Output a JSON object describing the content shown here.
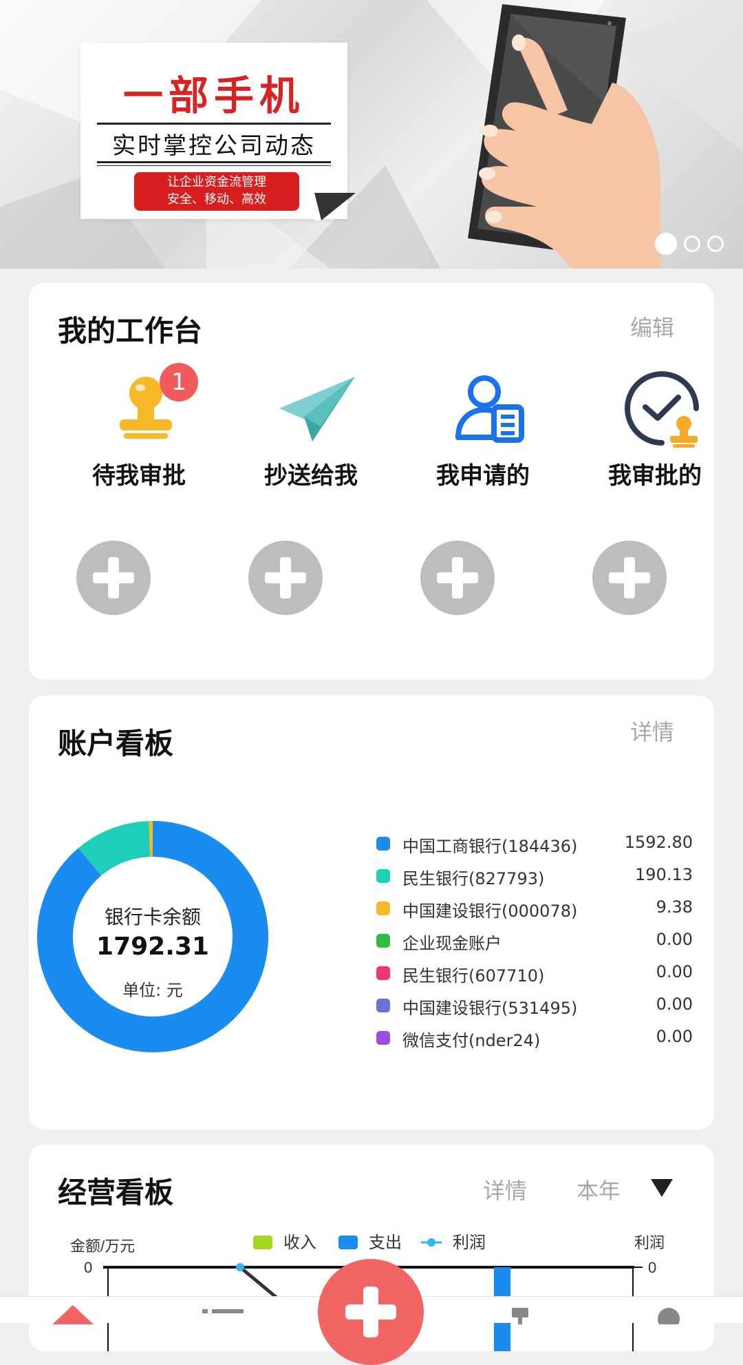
{
  "banner": {
    "headline": "一部手机",
    "subheadline": "实时掌控公司动态",
    "pill_line1": "让企业资金流管理",
    "pill_line2": "安全、移动、高效",
    "slides_total": 3,
    "slide_active": 1
  },
  "workbench": {
    "title": "我的工作台",
    "edit_label": "编辑",
    "items": [
      {
        "label": "待我审批",
        "icon": "stamp-icon",
        "badge": "1"
      },
      {
        "label": "抄送给我",
        "icon": "paper-plane-icon"
      },
      {
        "label": "我申请的",
        "icon": "person-document-icon"
      },
      {
        "label": "我审批的",
        "icon": "check-stamp-icon"
      }
    ]
  },
  "accounts": {
    "title": "账户看板",
    "detail_label": "详情",
    "center_label": "银行卡余额",
    "center_value": "1792.31",
    "center_unit": "单位: 元",
    "legend": [
      {
        "name": "中国工商银行(184436)",
        "value": "1592.80",
        "color": "#1a8cf0"
      },
      {
        "name": "民生银行(827793)",
        "value": "190.13",
        "color": "#1dcfb8"
      },
      {
        "name": "中国建设银行(000078)",
        "value": "9.38",
        "color": "#f7b928"
      },
      {
        "name": "企业现金账户",
        "value": "0.00",
        "color": "#2ebd3f"
      },
      {
        "name": "民生银行(607710)",
        "value": "0.00",
        "color": "#f0356e"
      },
      {
        "name": "中国建设银行(531495)",
        "value": "0.00",
        "color": "#6b73d6"
      },
      {
        "name": "微信支付(nder24)",
        "value": "0.00",
        "color": "#9b4ee6"
      }
    ]
  },
  "chart_data": {
    "type": "pie",
    "categories": [
      "中国工商银行(184436)",
      "民生银行(827793)",
      "中国建设银行(000078)",
      "企业现金账户",
      "民生银行(607710)",
      "中国建设银行(531495)",
      "微信支付(nder24)"
    ],
    "values": [
      1592.8,
      190.13,
      9.38,
      0.0,
      0.0,
      0.0,
      0.0
    ],
    "title": "银行卡余额"
  },
  "business": {
    "title": "经营看板",
    "detail_label": "详情",
    "period_label": "本年",
    "y_left_label": "金额/万元",
    "y_right_label": "利润",
    "y_left_tick": "0",
    "y_right_tick": "0",
    "legend": [
      {
        "name": "收入",
        "color": "#a3d81c"
      },
      {
        "name": "支出",
        "color": "#1a8cf0"
      },
      {
        "name": "利润",
        "color": "#2bb7f2"
      }
    ]
  },
  "nav": {
    "accent": "#f26565",
    "icons": [
      "home-icon",
      "list-icon",
      "add-icon",
      "report-icon",
      "profile-icon"
    ]
  }
}
